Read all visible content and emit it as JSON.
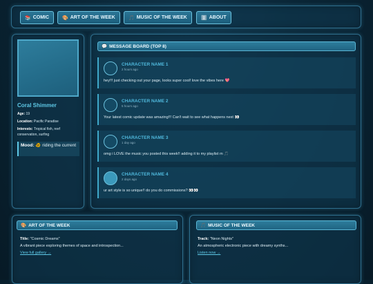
{
  "nav": {
    "items": [
      {
        "icon": "📚",
        "label": "COMIC"
      },
      {
        "icon": "🎨",
        "label": "ART OF THE WEEK"
      },
      {
        "icon": "🎵",
        "label": "MUSIC OF THE WEEK"
      },
      {
        "icon": "ℹ️",
        "label": "ABOUT"
      }
    ]
  },
  "profile": {
    "name": "Coral Shimmer",
    "age_label": "Age:",
    "age": "19",
    "location_label": "Location:",
    "location": "Pacific Paradise",
    "interests_label": "Interests:",
    "interests": "Tropical fish, reef conservation, surfing",
    "mood_label": "Mood:",
    "mood_icon": "🐠",
    "mood": "riding the current"
  },
  "board": {
    "icon": "💬",
    "title": "MESSAGE BOARD (TOP 8)",
    "posts": [
      {
        "name": "CHARACTER NAME 1",
        "time": "2 hours ago",
        "text": "hey!!! just checking out your page, looks super cool! love the vibes here 💖"
      },
      {
        "name": "CHARACTER NAME 2",
        "time": "5 hours ago",
        "text": "Your latest comic update was amazing!!! Can't wait to see what happens next 👀"
      },
      {
        "name": "CHARACTER NAME 3",
        "time": "1 day ago",
        "text": "omg i LOVE the music you posted this week!! adding it to my playlist rn 🎵"
      },
      {
        "name": "CHARACTER NAME 4",
        "time": "2 days ago",
        "text": "ur art style is so unique!! do you do commissions? 👀👀"
      }
    ]
  },
  "art": {
    "icon": "🎨",
    "title": "ART OF THE WEEK",
    "title_label": "Title:",
    "piece_title": "\"Cosmic Dreams\"",
    "description": "A vibrant piece exploring themes of space and introspection...",
    "link": "View full gallery →"
  },
  "music": {
    "icon": "🎵",
    "title": "MUSIC OF THE WEEK",
    "track_label": "Track:",
    "track": "\"Neon Nights\"",
    "description": "An atmospheric electronic piece with dreamy synths...",
    "link": "Listen now →"
  }
}
